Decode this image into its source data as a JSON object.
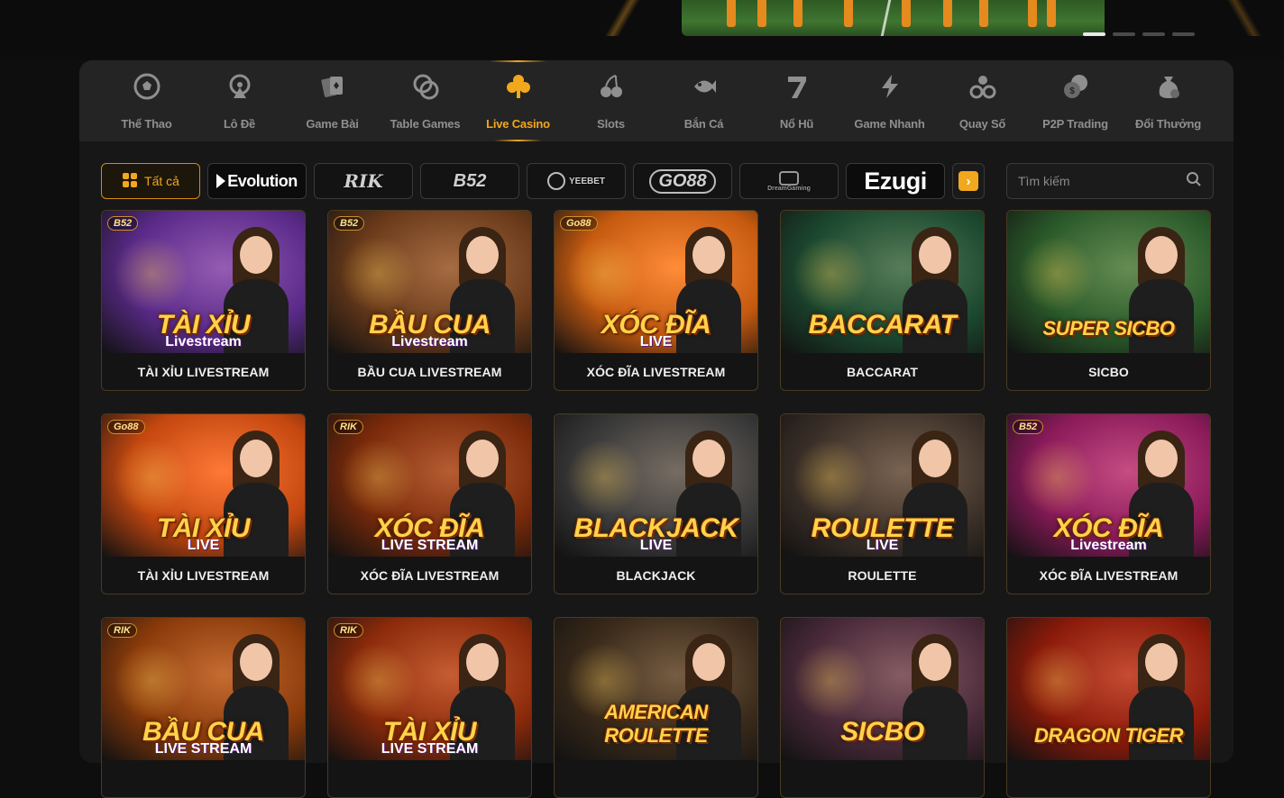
{
  "banner": {
    "slides": 4,
    "active_slide": 1
  },
  "categories": [
    {
      "label": "Thể Thao",
      "icon": "soccer-ball-icon",
      "active": false
    },
    {
      "label": "Lô Đề",
      "icon": "lottery-wheel-icon",
      "active": false
    },
    {
      "label": "Game Bài",
      "icon": "playing-cards-icon",
      "active": false
    },
    {
      "label": "Table Games",
      "icon": "casino-chips-icon",
      "active": false
    },
    {
      "label": "Live Casino",
      "icon": "clubs-icon",
      "active": true
    },
    {
      "label": "Slots",
      "icon": "cherries-icon",
      "active": false
    },
    {
      "label": "Bắn Cá",
      "icon": "fish-icon",
      "active": false
    },
    {
      "label": "Nổ Hũ",
      "icon": "seven-icon",
      "active": false
    },
    {
      "label": "Game Nhanh",
      "icon": "lightning-icon",
      "active": false
    },
    {
      "label": "Quay Số",
      "icon": "lottery-balls-icon",
      "active": false
    },
    {
      "label": "P2P Trading",
      "icon": "coins-icon",
      "active": false
    },
    {
      "label": "Đổi Thưởng",
      "icon": "money-bag-icon",
      "active": false
    }
  ],
  "providers": {
    "all_label": "Tất cả",
    "items": [
      "Evolution",
      "RIK",
      "B52",
      "YEEBET",
      "GO88",
      "DreamGaming",
      "Ezugi"
    ]
  },
  "search": {
    "placeholder": "Tìm kiếm"
  },
  "games": [
    {
      "name": "TÀI XỈU LIVESTREAM",
      "art_title": "TÀI XỈU",
      "art_sub": "Livestream",
      "badge": "B52",
      "bg": "#5a2a8a"
    },
    {
      "name": "BẦU CUA LIVESTREAM",
      "art_title": "BẦU CUA",
      "art_sub": "Livestream",
      "badge": "B52",
      "bg": "#6a3a1a"
    },
    {
      "name": "XÓC ĐĨA LIVESTREAM",
      "art_title": "XÓC ĐĨA",
      "art_sub": "LIVE",
      "badge": "Go88",
      "bg": "#c55a10"
    },
    {
      "name": "BACCARAT",
      "art_title": "BACCARAT",
      "art_sub": "",
      "badge": "",
      "bg": "#1c4a30"
    },
    {
      "name": "SICBO",
      "art_title": "SUPER SICBO",
      "art_sub": "",
      "badge": "",
      "bg": "#2a5a2a"
    },
    {
      "name": "TÀI XỈU LIVESTREAM",
      "art_title": "TÀI XỈU",
      "art_sub": "LIVE",
      "badge": "Go88",
      "bg": "#c4470f"
    },
    {
      "name": "XÓC ĐĨA LIVESTREAM",
      "art_title": "XÓC ĐĨA",
      "art_sub": "LIVE STREAM",
      "badge": "RIK",
      "bg": "#7a2a0a"
    },
    {
      "name": "BLACKJACK",
      "art_title": "BLACKJACK",
      "art_sub": "LIVE",
      "badge": "",
      "bg": "#3a3a3a"
    },
    {
      "name": "ROULETTE",
      "art_title": "ROULETTE",
      "art_sub": "LIVE",
      "badge": "",
      "bg": "#3d3129"
    },
    {
      "name": "XÓC ĐĨA LIVESTREAM",
      "art_title": "XÓC ĐĨA",
      "art_sub": "Livestream",
      "badge": "B52",
      "bg": "#8a1a5a"
    },
    {
      "name": "",
      "art_title": "BẦU CUA",
      "art_sub": "LIVE STREAM",
      "badge": "RIK",
      "bg": "#8a3a0a"
    },
    {
      "name": "",
      "art_title": "TÀI XỈU",
      "art_sub": "LIVE STREAM",
      "badge": "RIK",
      "bg": "#8a2a0a"
    },
    {
      "name": "",
      "art_title": "AMERICAN ROULETTE",
      "art_sub": "",
      "badge": "",
      "bg": "#3a2a1a"
    },
    {
      "name": "",
      "art_title": "SICBO",
      "art_sub": "",
      "badge": "",
      "bg": "#4a2a3a"
    },
    {
      "name": "",
      "art_title": "DRAGON TIGER",
      "art_sub": "",
      "badge": "",
      "bg": "#8a1a0a"
    }
  ],
  "colors": {
    "accent": "#f2a81c",
    "panel": "#171717",
    "tabbar": "#242424"
  }
}
